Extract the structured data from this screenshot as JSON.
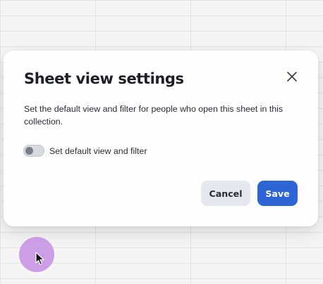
{
  "dialog": {
    "title": "Sheet view settings",
    "close_icon": "close-icon",
    "description": "Set the default view and filter for people who open this sheet in this collection.",
    "toggle": {
      "label": "Set default view and filter",
      "checked": false
    },
    "cancel_label": "Cancel",
    "save_label": "Save"
  },
  "colors": {
    "primary": "#2d64d6",
    "secondary_button": "#e6e7ef",
    "cursor_highlight": "#c48ee2"
  }
}
